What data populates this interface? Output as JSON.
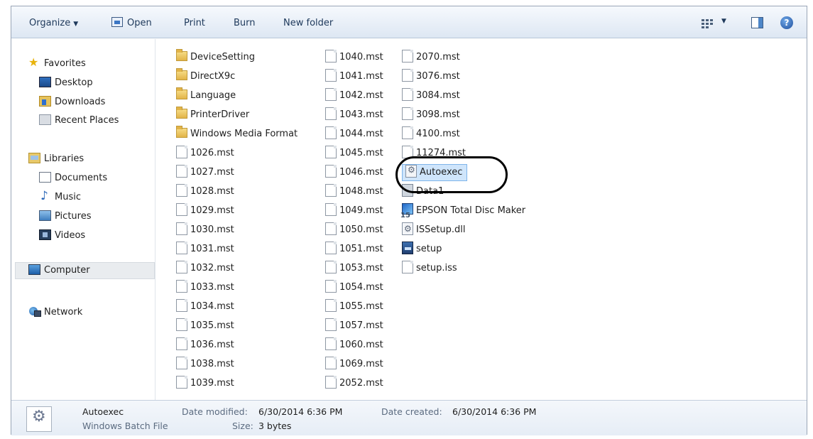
{
  "toolbar": {
    "organize": "Organize",
    "open": "Open",
    "print": "Print",
    "burn": "Burn",
    "new_folder": "New folder",
    "views_icon": "views-icon",
    "preview_pane_icon": "preview-pane-icon",
    "help_icon": "help-icon",
    "help_glyph": "?"
  },
  "nav": {
    "favorites": "Favorites",
    "desktop": "Desktop",
    "downloads": "Downloads",
    "recent_places": "Recent Places",
    "libraries": "Libraries",
    "documents": "Documents",
    "music": "Music",
    "pictures": "Pictures",
    "videos": "Videos",
    "computer": "Computer",
    "network": "Network"
  },
  "files": {
    "col1": [
      {
        "name": "DeviceSetting",
        "type": "folder"
      },
      {
        "name": "DirectX9c",
        "type": "folder"
      },
      {
        "name": "Language",
        "type": "folder"
      },
      {
        "name": "PrinterDriver",
        "type": "folder"
      },
      {
        "name": "Windows Media Format",
        "type": "folder"
      },
      {
        "name": "1026.mst",
        "type": "doc"
      },
      {
        "name": "1027.mst",
        "type": "doc"
      },
      {
        "name": "1028.mst",
        "type": "doc"
      },
      {
        "name": "1029.mst",
        "type": "doc"
      },
      {
        "name": "1030.mst",
        "type": "doc"
      },
      {
        "name": "1031.mst",
        "type": "doc"
      },
      {
        "name": "1032.mst",
        "type": "doc"
      },
      {
        "name": "1033.mst",
        "type": "doc"
      },
      {
        "name": "1034.mst",
        "type": "doc"
      },
      {
        "name": "1035.mst",
        "type": "doc"
      },
      {
        "name": "1036.mst",
        "type": "doc"
      },
      {
        "name": "1038.mst",
        "type": "doc"
      },
      {
        "name": "1039.mst",
        "type": "doc"
      }
    ],
    "col2": [
      {
        "name": "1040.mst",
        "type": "doc"
      },
      {
        "name": "1041.mst",
        "type": "doc"
      },
      {
        "name": "1042.mst",
        "type": "doc"
      },
      {
        "name": "1043.mst",
        "type": "doc"
      },
      {
        "name": "1044.mst",
        "type": "doc"
      },
      {
        "name": "1045.mst",
        "type": "doc"
      },
      {
        "name": "1046.mst",
        "type": "doc"
      },
      {
        "name": "1048.mst",
        "type": "doc"
      },
      {
        "name": "1049.mst",
        "type": "doc"
      },
      {
        "name": "1050.mst",
        "type": "doc"
      },
      {
        "name": "1051.mst",
        "type": "doc"
      },
      {
        "name": "1053.mst",
        "type": "doc"
      },
      {
        "name": "1054.mst",
        "type": "doc"
      },
      {
        "name": "1055.mst",
        "type": "doc"
      },
      {
        "name": "1057.mst",
        "type": "doc"
      },
      {
        "name": "1060.mst",
        "type": "doc"
      },
      {
        "name": "1069.mst",
        "type": "doc"
      },
      {
        "name": "2052.mst",
        "type": "doc"
      }
    ],
    "col3": [
      {
        "name": "2070.mst",
        "type": "doc"
      },
      {
        "name": "3076.mst",
        "type": "doc"
      },
      {
        "name": "3084.mst",
        "type": "doc"
      },
      {
        "name": "3098.mst",
        "type": "doc"
      },
      {
        "name": "4100.mst",
        "type": "doc"
      },
      {
        "name": "11274.mst",
        "type": "doc"
      },
      {
        "name": "Autoexec",
        "type": "gear",
        "selected": true
      },
      {
        "name": "Data1",
        "type": "data"
      },
      {
        "name": "EPSON Total Disc Maker",
        "type": "epson"
      },
      {
        "name": "ISSetup.dll",
        "type": "gear"
      },
      {
        "name": "setup",
        "type": "setup"
      },
      {
        "name": "setup.iss",
        "type": "doc"
      }
    ]
  },
  "details": {
    "name": "Autoexec",
    "type": "Windows Batch File",
    "modified_label": "Date modified:",
    "modified_value": "6/30/2014 6:36 PM",
    "size_label": "Size:",
    "size_value": "3 bytes",
    "created_label": "Date created:",
    "created_value": "6/30/2014 6:36 PM"
  }
}
